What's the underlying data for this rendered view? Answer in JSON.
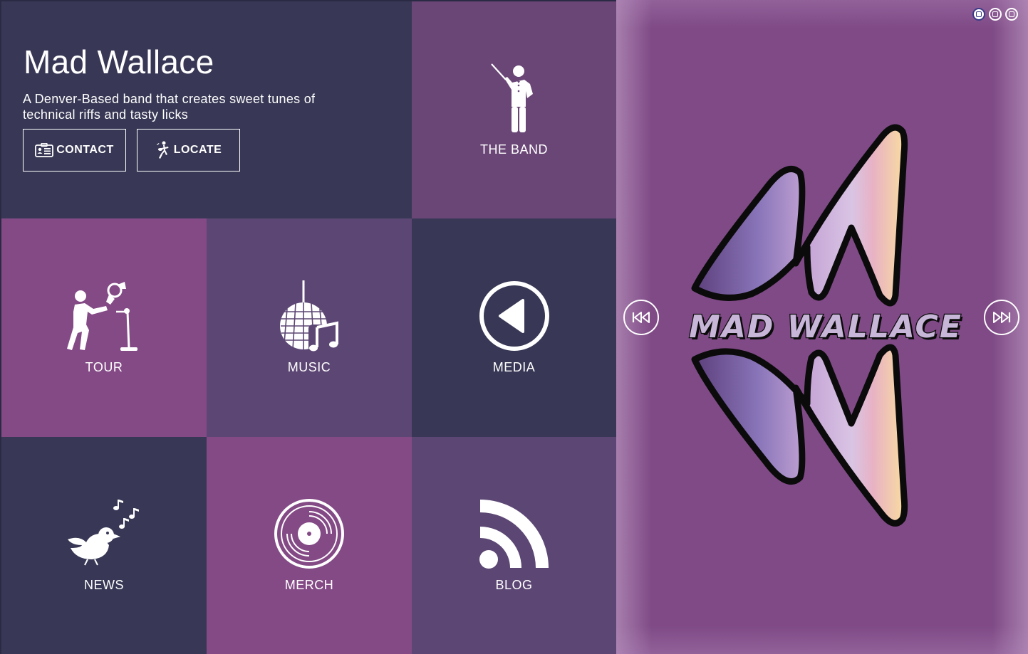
{
  "hero": {
    "title": "Mad Wallace",
    "subtitle": "A Denver-Based band that creates sweet tunes of technical riffs and tasty licks",
    "contact_label": "CONTACT",
    "locate_label": "LOCATE"
  },
  "tiles": {
    "band": {
      "label": "THE BAND",
      "icon": "conductor-icon"
    },
    "tour": {
      "label": "TOUR",
      "icon": "singer-microphone-icon"
    },
    "music": {
      "label": "MUSIC",
      "icon": "disco-ball-music-note-icon"
    },
    "media": {
      "label": "MEDIA",
      "icon": "play-circle-icon"
    },
    "news": {
      "label": "NEWS",
      "icon": "singing-bird-icon"
    },
    "merch": {
      "label": "MERCH",
      "icon": "vinyl-record-icon"
    },
    "blog": {
      "label": "BLOG",
      "icon": "rss-feed-icon"
    }
  },
  "slider": {
    "logo_text": "MAD WALLACE",
    "dots": 3,
    "active_dot": 0,
    "prev_icon": "rewind-icon",
    "next_icon": "fast-forward-icon"
  },
  "colors": {
    "navy": "#383856",
    "plum": "#6a4676",
    "magenta": "#844a86",
    "violet": "#5c4674",
    "slider_bg": "#7f4a86"
  }
}
